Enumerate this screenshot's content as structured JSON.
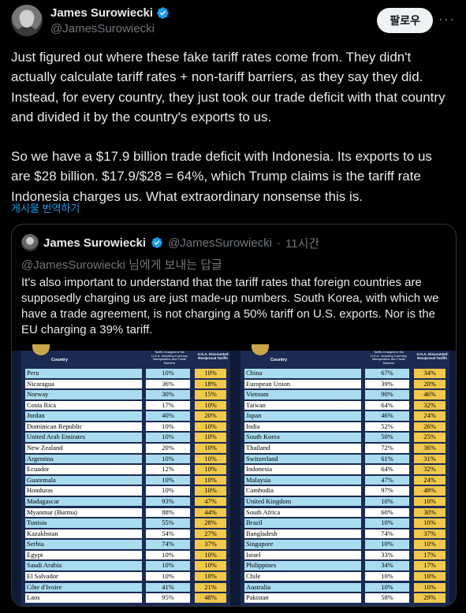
{
  "author": {
    "name": "James Surowiecki",
    "handle": "@JamesSurowiecki"
  },
  "follow_label": "팔로우",
  "more_label": "···",
  "tweet": {
    "paragraphs": [
      "Just figured out where these fake tariff rates come from. They didn't actually calculate tariff rates + non-tariff barriers, as they say they did. Instead, for every country, they just took our trade deficit with that country and divided it by the country's exports to us.",
      "So we have a $17.9 billion trade deficit with Indonesia. Its exports to us are $28 billion. $17.9/$28 = 64%, which Trump claims is the tariff rate Indonesia charges us. What extraordinary nonsense this is."
    ],
    "translate_label": "게시물 번역하기"
  },
  "quote": {
    "name": "James Surowiecki",
    "handle": "@JamesSurowiecki",
    "separator": "·",
    "time": "11시간",
    "reply_to": "@JamesSurowiecki 님에게 보내는 답글",
    "text": "It's also important to understand that the tariff rates that foreign countries are supposedly charging us are just made-up numbers. South Korea, with which we have a trade agreement, is not charging a 50% tariff on U.S. exports. Nor is the EU charging a 39% tariff."
  },
  "table_header": {
    "country": "Country",
    "rate": "Tariffs Charged to the U.S.A. Including Currency Manipulation and Trade Barriers",
    "reciprocal": "U.S.A. Discounted Reciprocal Tariffs"
  },
  "left_table": [
    {
      "country": "Peru",
      "rate": "10%",
      "tariff": "10%"
    },
    {
      "country": "Nicaragua",
      "rate": "36%",
      "tariff": "18%"
    },
    {
      "country": "Norway",
      "rate": "30%",
      "tariff": "15%"
    },
    {
      "country": "Costa Rica",
      "rate": "17%",
      "tariff": "10%"
    },
    {
      "country": "Jordan",
      "rate": "40%",
      "tariff": "20%"
    },
    {
      "country": "Dominican Republic",
      "rate": "10%",
      "tariff": "10%"
    },
    {
      "country": "United Arab Emirates",
      "rate": "10%",
      "tariff": "10%"
    },
    {
      "country": "New Zealand",
      "rate": "20%",
      "tariff": "10%"
    },
    {
      "country": "Argentina",
      "rate": "10%",
      "tariff": "10%"
    },
    {
      "country": "Ecuador",
      "rate": "12%",
      "tariff": "10%"
    },
    {
      "country": "Guatemala",
      "rate": "10%",
      "tariff": "10%"
    },
    {
      "country": "Honduras",
      "rate": "10%",
      "tariff": "10%"
    },
    {
      "country": "Madagascar",
      "rate": "93%",
      "tariff": "47%"
    },
    {
      "country": "Myanmar (Burma)",
      "rate": "88%",
      "tariff": "44%"
    },
    {
      "country": "Tunisia",
      "rate": "55%",
      "tariff": "28%"
    },
    {
      "country": "Kazakhstan",
      "rate": "54%",
      "tariff": "27%"
    },
    {
      "country": "Serbia",
      "rate": "74%",
      "tariff": "37%"
    },
    {
      "country": "Egypt",
      "rate": "10%",
      "tariff": "10%"
    },
    {
      "country": "Saudi Arabia",
      "rate": "10%",
      "tariff": "10%"
    },
    {
      "country": "El Salvador",
      "rate": "10%",
      "tariff": "10%"
    },
    {
      "country": "Côte d'Ivoire",
      "rate": "41%",
      "tariff": "21%"
    },
    {
      "country": "Laos",
      "rate": "95%",
      "tariff": "48%"
    }
  ],
  "right_table": [
    {
      "country": "China",
      "rate": "67%",
      "tariff": "34%"
    },
    {
      "country": "European Union",
      "rate": "39%",
      "tariff": "20%"
    },
    {
      "country": "Vietnam",
      "rate": "90%",
      "tariff": "46%"
    },
    {
      "country": "Taiwan",
      "rate": "64%",
      "tariff": "32%"
    },
    {
      "country": "Japan",
      "rate": "46%",
      "tariff": "24%"
    },
    {
      "country": "India",
      "rate": "52%",
      "tariff": "26%"
    },
    {
      "country": "South Korea",
      "rate": "50%",
      "tariff": "25%"
    },
    {
      "country": "Thailand",
      "rate": "72%",
      "tariff": "36%"
    },
    {
      "country": "Switzerland",
      "rate": "61%",
      "tariff": "31%"
    },
    {
      "country": "Indonesia",
      "rate": "64%",
      "tariff": "32%"
    },
    {
      "country": "Malaysia",
      "rate": "47%",
      "tariff": "24%"
    },
    {
      "country": "Cambodia",
      "rate": "97%",
      "tariff": "49%"
    },
    {
      "country": "United Kingdom",
      "rate": "10%",
      "tariff": "10%"
    },
    {
      "country": "South Africa",
      "rate": "60%",
      "tariff": "30%"
    },
    {
      "country": "Brazil",
      "rate": "10%",
      "tariff": "10%"
    },
    {
      "country": "Bangladesh",
      "rate": "74%",
      "tariff": "37%"
    },
    {
      "country": "Singapore",
      "rate": "10%",
      "tariff": "10%"
    },
    {
      "country": "Israel",
      "rate": "33%",
      "tariff": "17%"
    },
    {
      "country": "Philippines",
      "rate": "34%",
      "tariff": "17%"
    },
    {
      "country": "Chile",
      "rate": "10%",
      "tariff": "10%"
    },
    {
      "country": "Australia",
      "rate": "10%",
      "tariff": "10%"
    },
    {
      "country": "Pakistan",
      "rate": "58%",
      "tariff": "29%"
    }
  ]
}
